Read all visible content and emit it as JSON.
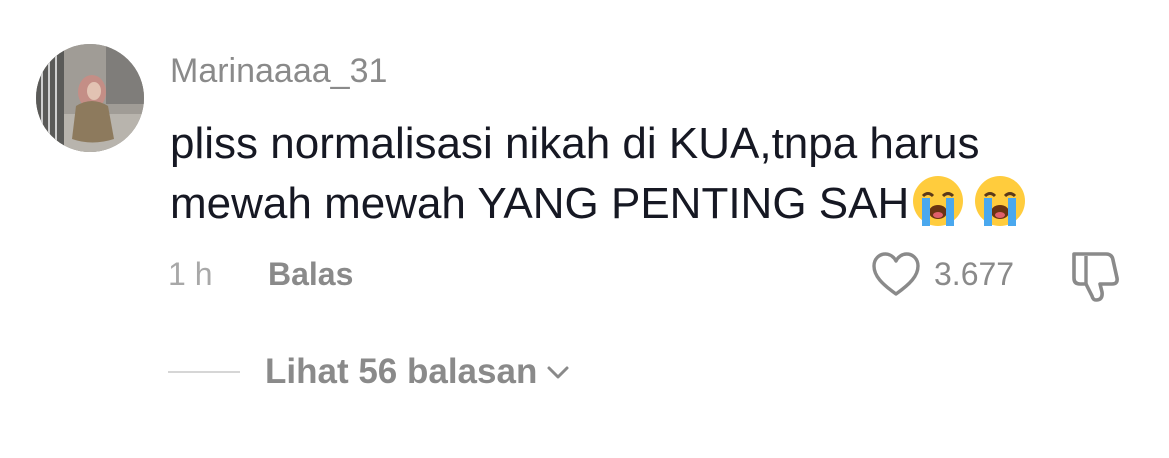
{
  "comment": {
    "username": "Marinaaaa_31",
    "text": "pliss normalisasi nikah di KUA,tnpa harus mewah mewah YANG PENTING SAH",
    "emojis": [
      "loudly-crying-face",
      "loudly-crying-face"
    ],
    "time": "1 h",
    "reply_label": "Balas",
    "like_count": "3.677",
    "view_replies_label": "Lihat 56 balasan"
  },
  "colors": {
    "text_primary": "#161823",
    "text_secondary": "#8a8a8a",
    "text_muted": "#a8a8a8",
    "divider": "#d6d6d6"
  },
  "icons": {
    "like": "heart-outline-icon",
    "dislike": "thumbs-down-outline-icon",
    "expand": "chevron-down-icon"
  }
}
